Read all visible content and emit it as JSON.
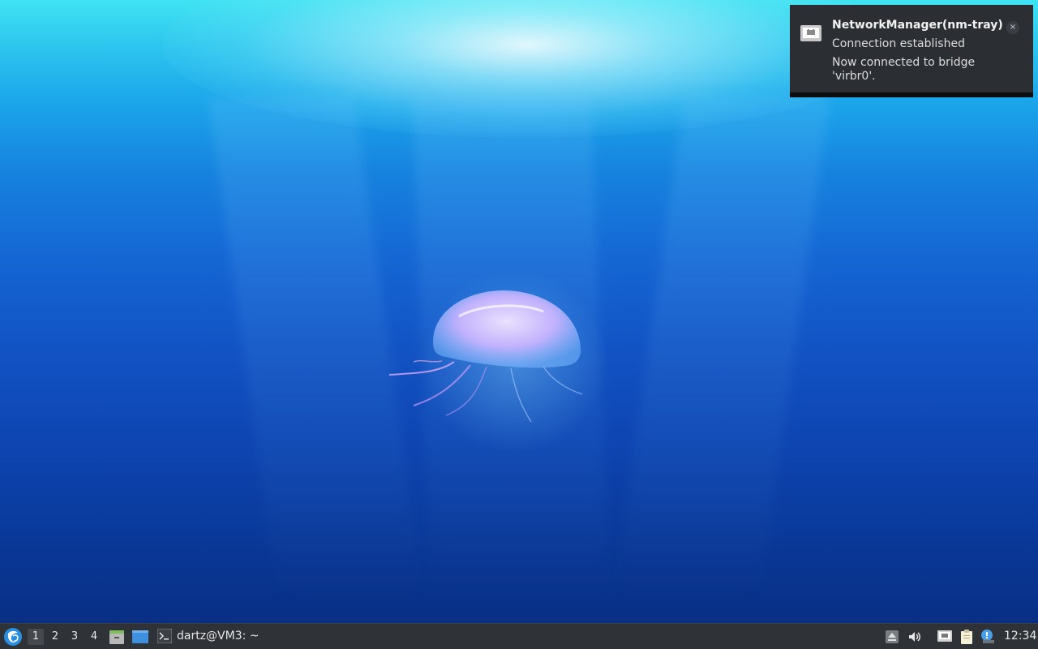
{
  "notification": {
    "title": "NetworkManager(nm-tray)",
    "summary": "Connection established",
    "body": "Now connected to bridge 'virbr0'.",
    "close_glyph": "×",
    "icon": "network-wired-icon"
  },
  "taskbar": {
    "start_icon": "lxqt-menu-icon",
    "desktops": [
      {
        "label": "1",
        "active": true
      },
      {
        "label": "2",
        "active": false
      },
      {
        "label": "3",
        "active": false
      },
      {
        "label": "4",
        "active": false
      }
    ],
    "quicklaunch": [
      "file-manager-icon",
      "show-desktop-icon"
    ],
    "tasks": [
      {
        "label": "dartz@VM3: ~",
        "icon": "terminal-icon"
      }
    ],
    "tray": [
      "removable-media-icon",
      "volume-icon",
      "network-wired-icon",
      "clipboard-icon",
      "update-notifier-icon"
    ],
    "clock": "12:34"
  },
  "colors": {
    "panel_bg": "#2f3237",
    "notification_bg": "#2b2e33",
    "accent": "#2b8fe0"
  }
}
